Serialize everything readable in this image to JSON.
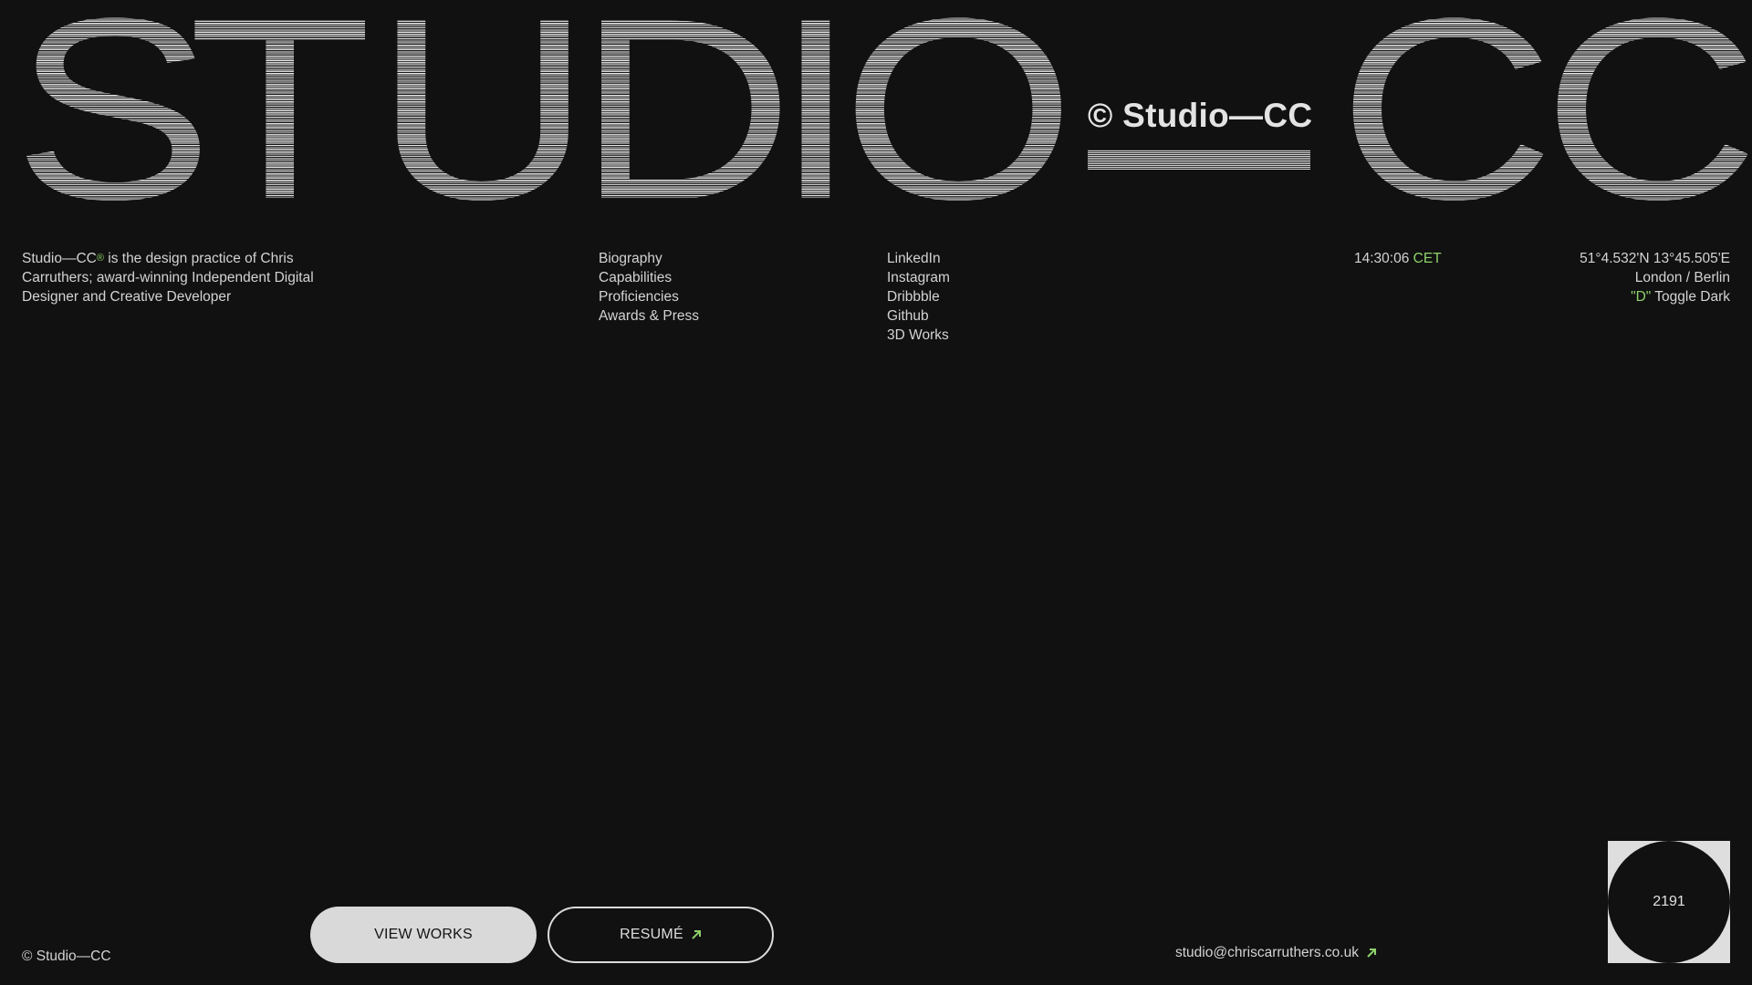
{
  "hero": {
    "letters": [
      "S",
      "T",
      "U",
      "D",
      "I",
      "O",
      "C",
      "C"
    ],
    "brand": "© Studio—CC"
  },
  "intro": {
    "name": "Studio—CC",
    "registered_mark": "®",
    "text": " is the design practice of Chris Carruthers; award-winning Independent Digital Designer and Creative Developer"
  },
  "nav_main": {
    "items": [
      "Biography",
      "Capabilities",
      "Proficiencies",
      "Awards & Press"
    ]
  },
  "nav_social": {
    "items": [
      "LinkedIn",
      "Instagram",
      "Dribbble",
      "Github",
      "3D Works"
    ]
  },
  "clock": {
    "time": "14:30:06",
    "zone": "CET"
  },
  "geo": {
    "coords": "51°4.532'N 13°45.505'E",
    "cities": "London / Berlin",
    "toggle_key": "\"D\"",
    "toggle_label": " Toggle Dark"
  },
  "footer": {
    "copyright": "© Studio—CC",
    "view_works_label": "VIEW WORKS",
    "resume_label": "RESUMÉ",
    "email": "studio@chriscarruthers.co.uk",
    "counter": "2191"
  },
  "colors": {
    "background": "#111111",
    "accent": "#8ed16a",
    "text": "#d3d3d3"
  },
  "icons": {
    "link_arrow": "arrow-up-right-icon"
  }
}
